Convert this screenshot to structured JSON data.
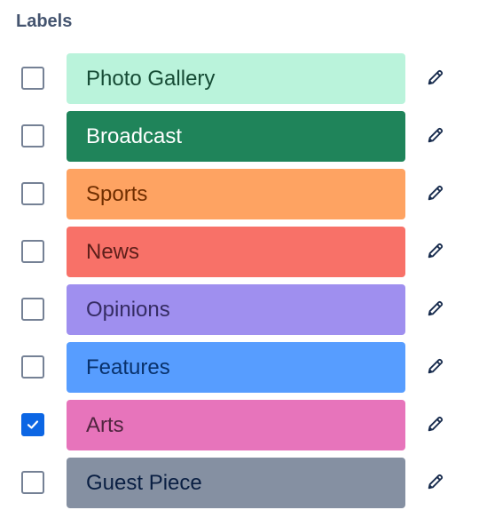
{
  "heading": "Labels",
  "labels": [
    {
      "name": "Photo Gallery",
      "checked": false,
      "bg": "#baf3db",
      "fg": "#164b35"
    },
    {
      "name": "Broadcast",
      "checked": false,
      "bg": "#1f845a",
      "fg": "#ffffff"
    },
    {
      "name": "Sports",
      "checked": false,
      "bg": "#fea362",
      "fg": "#702e00"
    },
    {
      "name": "News",
      "checked": false,
      "bg": "#f87168",
      "fg": "#5d1f1a"
    },
    {
      "name": "Opinions",
      "checked": false,
      "bg": "#9f8fef",
      "fg": "#352c63"
    },
    {
      "name": "Features",
      "checked": false,
      "bg": "#579dff",
      "fg": "#09326c"
    },
    {
      "name": "Arts",
      "checked": true,
      "bg": "#e774bb",
      "fg": "#50253f"
    },
    {
      "name": "Guest Piece",
      "checked": false,
      "bg": "#8590a2",
      "fg": "#091e42"
    }
  ],
  "icons": {
    "edit": "pencil-icon",
    "check": "checkmark-icon"
  },
  "colors": {
    "checkbox_checked": "#0c66e4",
    "checkbox_border": "#758195",
    "heading": "#44546f"
  }
}
